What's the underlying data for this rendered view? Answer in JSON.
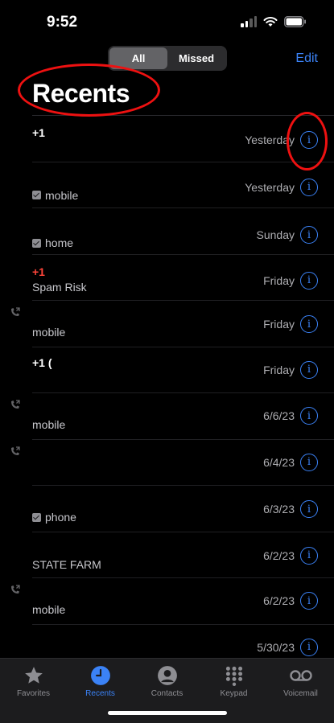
{
  "status": {
    "time": "9:52"
  },
  "header": {
    "filter_all": "All",
    "filter_missed": "Missed",
    "edit": "Edit",
    "title": "Recents"
  },
  "rows": [
    {
      "name": "+1",
      "sub": "",
      "date": "Yesterday"
    },
    {
      "name": "",
      "sub": "mobile",
      "date": "Yesterday"
    },
    {
      "name": "",
      "sub": "home",
      "date": "Sunday"
    },
    {
      "name": "+1",
      "sub": "Spam Risk",
      "date": "Friday"
    },
    {
      "name": "",
      "sub": "mobile",
      "date": "Friday"
    },
    {
      "name": "+1 (",
      "sub": "",
      "date": "Friday"
    },
    {
      "name": "",
      "sub": "mobile",
      "date": "6/6/23"
    },
    {
      "name": "",
      "sub": "",
      "date": "6/4/23"
    },
    {
      "name": "",
      "sub": "phone",
      "date": "6/3/23"
    },
    {
      "name": "",
      "sub": "STATE FARM",
      "date": "6/2/23"
    },
    {
      "name": "",
      "sub": "mobile",
      "date": "6/2/23"
    },
    {
      "name": "",
      "sub": "",
      "date": "5/30/23"
    }
  ],
  "tabbar": {
    "favorites": "Favorites",
    "recents": "Recents",
    "contacts": "Contacts",
    "keypad": "Keypad",
    "voicemail": "Voicemail"
  },
  "colors": {
    "accent": "#3b82f6",
    "spam": "#ff453a",
    "annotation": "#e11111"
  }
}
